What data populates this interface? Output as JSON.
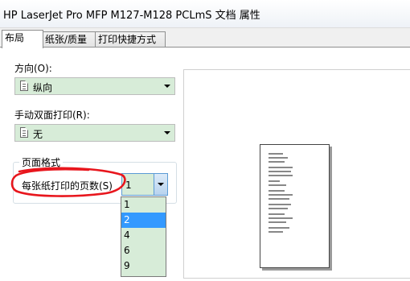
{
  "window": {
    "title": "HP LaserJet Pro MFP M127-M128 PCLmS 文档 属性"
  },
  "tabs": [
    {
      "label": "布局",
      "active": true
    },
    {
      "label": "纸张/质量",
      "active": false
    },
    {
      "label": "打印快捷方式",
      "active": false
    }
  ],
  "orientation": {
    "label": "方向(O):",
    "value": "纵向"
  },
  "duplex": {
    "label": "手动双面打印(R):",
    "value": "无"
  },
  "page_format": {
    "group_title": "页面格式",
    "pages_per_sheet_label": "每张纸打印的页数(S)",
    "pages_per_sheet_value": "1",
    "options": [
      "1",
      "2",
      "4",
      "6",
      "9"
    ],
    "highlighted_option": "2"
  },
  "colors": {
    "field_bg": "#d7ecd8",
    "selection": "#3399ff",
    "annotation": "#e8161d"
  }
}
